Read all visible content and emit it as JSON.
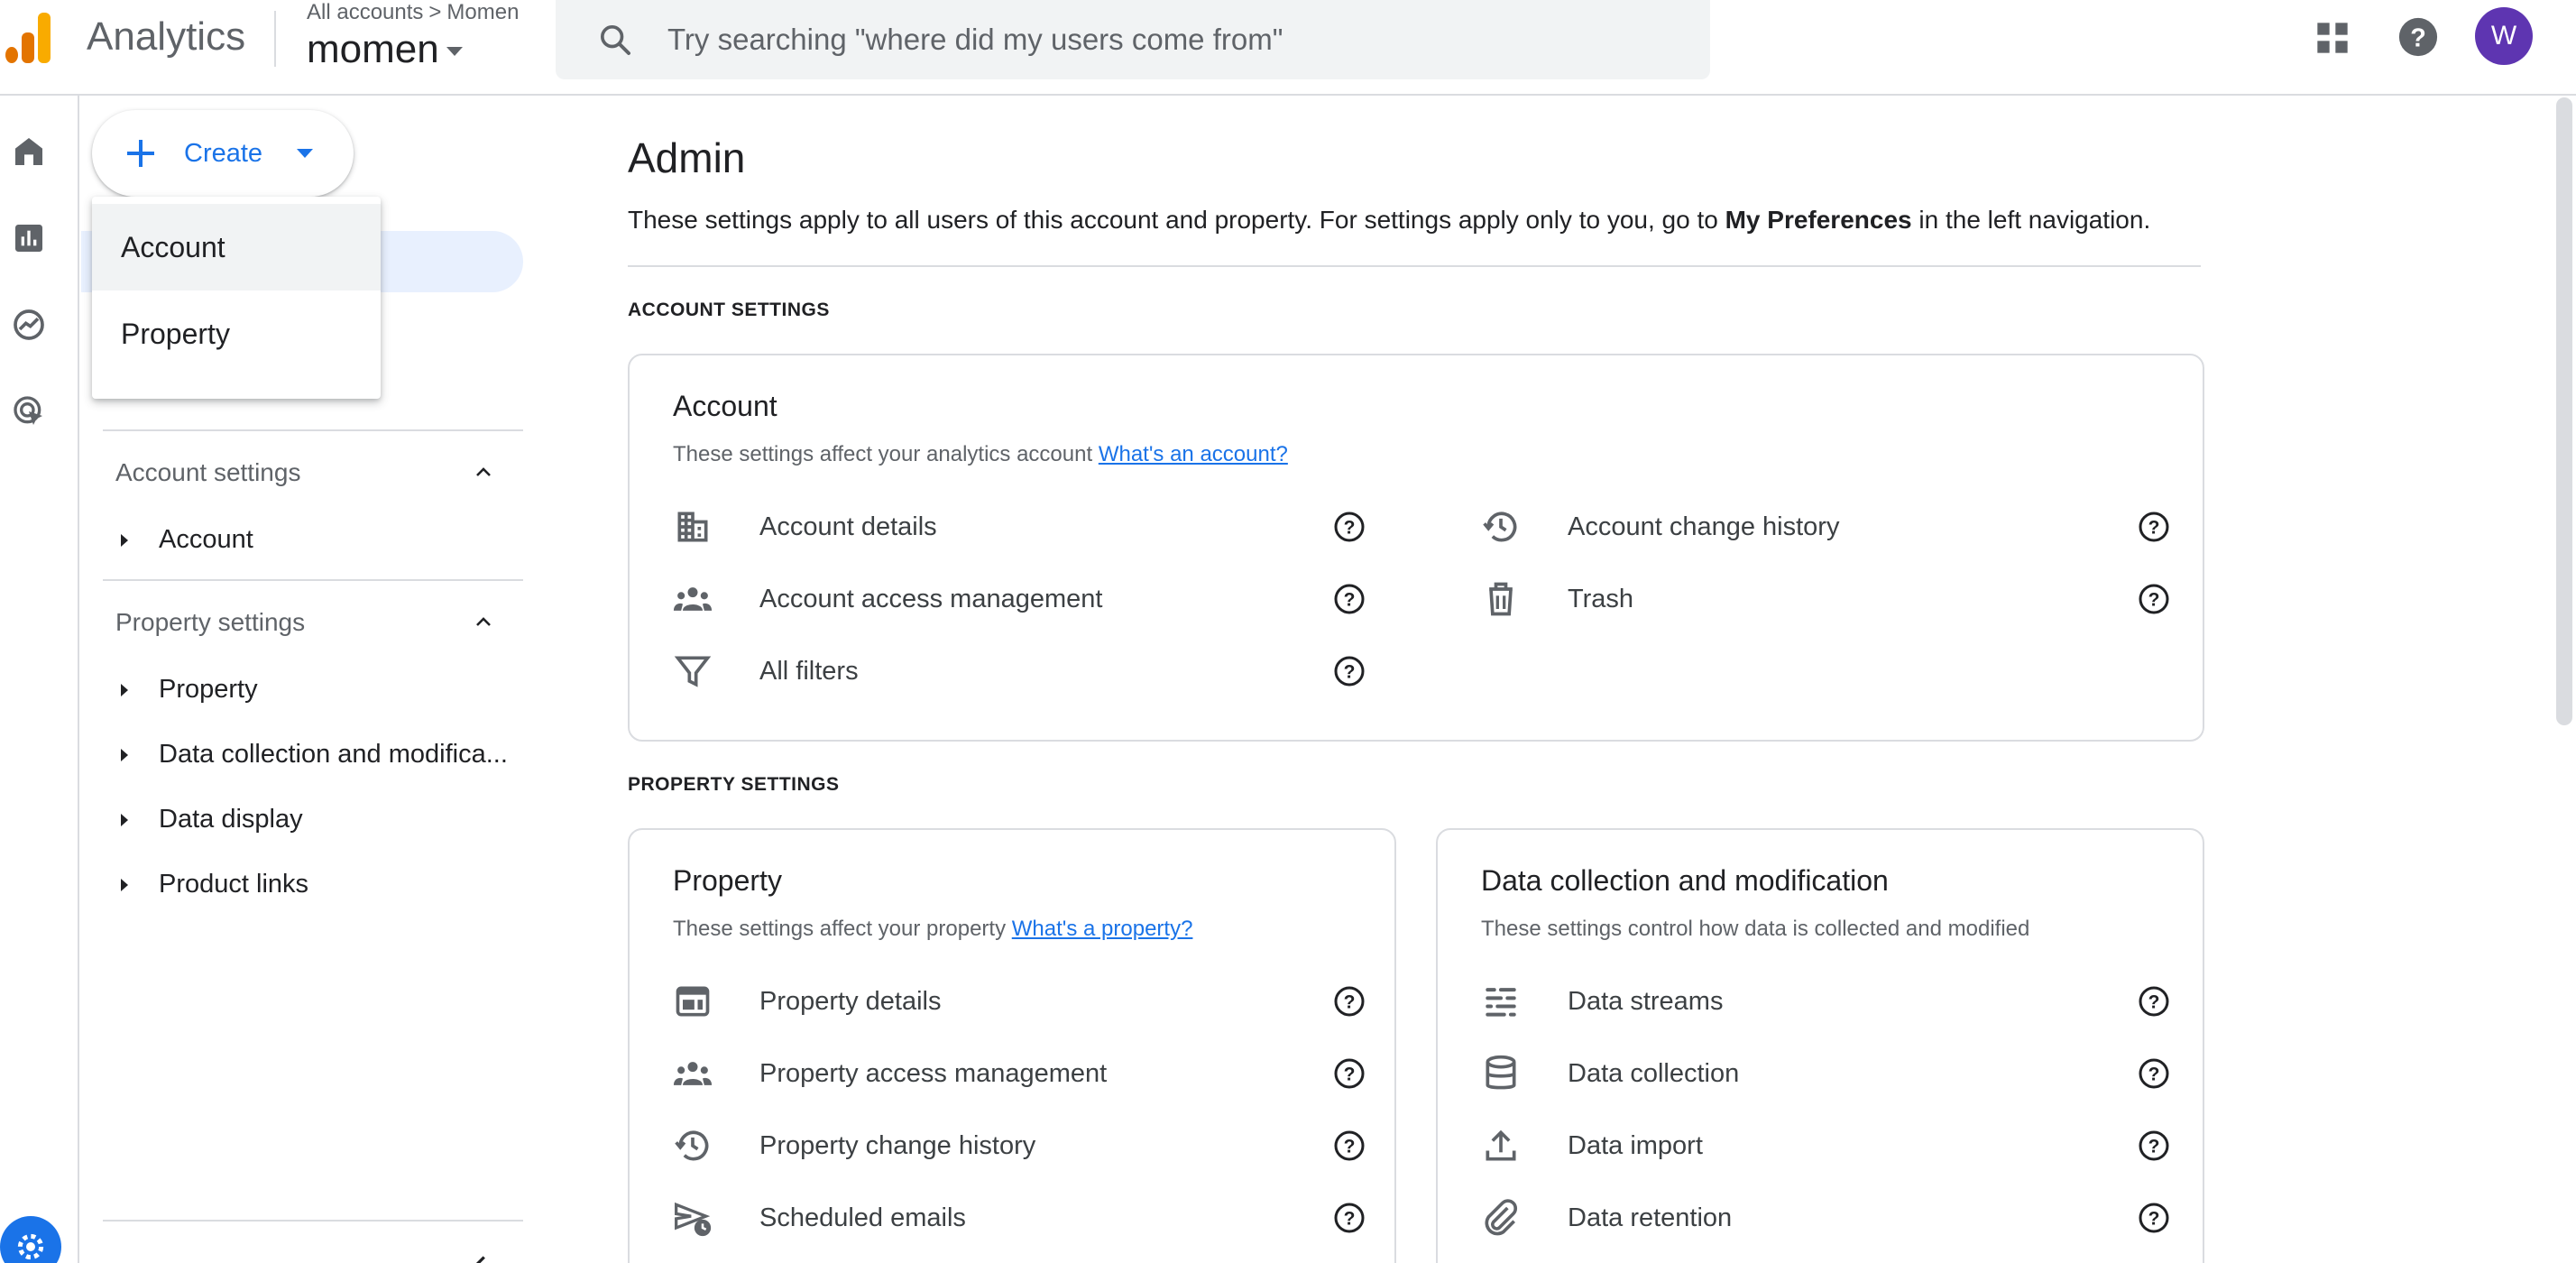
{
  "app": {
    "product_name": "Analytics",
    "breadcrumb_root": "All accounts",
    "breadcrumb_current": "Momen",
    "account_name": "momen",
    "search_placeholder": "Try searching \"where did my users come from\"",
    "avatar_initial": "W",
    "colors": {
      "accent": "#1a73e8",
      "avatar": "#5e35b1",
      "logo_orange": "#f9ab00",
      "logo_dark_orange": "#e37400"
    }
  },
  "create": {
    "label": "Create",
    "options": [
      "Account",
      "Property"
    ]
  },
  "nav": {
    "account_section": "Account settings",
    "account_items": [
      "Account"
    ],
    "property_section": "Property settings",
    "property_items": [
      "Property",
      "Data collection and modifica...",
      "Data display",
      "Product links"
    ]
  },
  "main": {
    "title": "Admin",
    "intro_before": "These settings apply to all users of this account and property. For settings apply only to you, go to ",
    "intro_bold": "My Preferences",
    "intro_after": " in the left navigation.",
    "account_settings_label": "ACCOUNT SETTINGS",
    "property_settings_label": "PROPERTY SETTINGS",
    "account_card": {
      "title": "Account",
      "desc": "These settings affect your analytics account ",
      "link": "What's an account?",
      "left_items": [
        {
          "label": "Account details",
          "icon": "building-icon"
        },
        {
          "label": "Account access management",
          "icon": "people-icon"
        },
        {
          "label": "All filters",
          "icon": "filter-icon"
        }
      ],
      "right_items": [
        {
          "label": "Account change history",
          "icon": "history-icon"
        },
        {
          "label": "Trash",
          "icon": "trash-icon"
        }
      ]
    },
    "property_card": {
      "title": "Property",
      "desc": "These settings affect your property ",
      "link": "What's a property?",
      "items": [
        {
          "label": "Property details",
          "icon": "web-icon"
        },
        {
          "label": "Property access management",
          "icon": "people-icon"
        },
        {
          "label": "Property change history",
          "icon": "history-icon"
        },
        {
          "label": "Scheduled emails",
          "icon": "scheduled-send-icon"
        }
      ]
    },
    "data_card": {
      "title": "Data collection and modification",
      "desc": "These settings control how data is collected and modified",
      "items": [
        {
          "label": "Data streams",
          "icon": "streams-icon"
        },
        {
          "label": "Data collection",
          "icon": "database-icon"
        },
        {
          "label": "Data import",
          "icon": "upload-icon"
        },
        {
          "label": "Data retention",
          "icon": "paperclip-icon"
        }
      ]
    }
  }
}
